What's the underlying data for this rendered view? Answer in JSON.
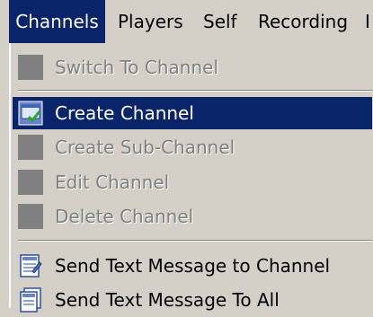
{
  "menubar": {
    "items": [
      {
        "label": "Channels",
        "active": true
      },
      {
        "label": "Players"
      },
      {
        "label": "Self"
      },
      {
        "label": "Recording"
      },
      {
        "label": "I"
      }
    ]
  },
  "dropdown": {
    "items": [
      {
        "label": "Switch To Channel",
        "enabled": false
      },
      {
        "label": "Create Channel",
        "enabled": true,
        "highlighted": true,
        "icon": "create-channel-icon"
      },
      {
        "label": "Create Sub-Channel",
        "enabled": false
      },
      {
        "label": "Edit Channel",
        "enabled": false
      },
      {
        "label": "Delete Channel",
        "enabled": false
      },
      {
        "label": "Send Text Message to Channel",
        "enabled": true,
        "icon": "message-icon"
      },
      {
        "label": "Send Text Message To All",
        "enabled": true,
        "icon": "message-all-icon"
      }
    ]
  },
  "colors": {
    "menu_bg": "#d4d0c8",
    "highlight": "#0a246a",
    "disabled_text": "#808080"
  }
}
